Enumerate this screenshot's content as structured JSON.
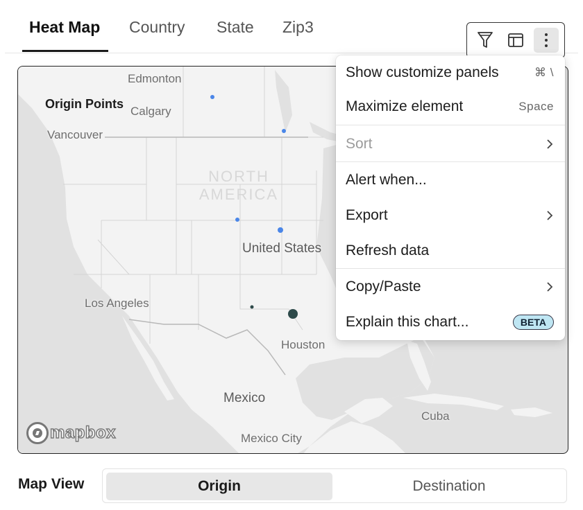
{
  "tabs": [
    {
      "label": "Heat Map",
      "active": true
    },
    {
      "label": "Country",
      "active": false
    },
    {
      "label": "State",
      "active": false
    },
    {
      "label": "Zip3",
      "active": false
    }
  ],
  "toolbar": {
    "icons": [
      "filter-icon",
      "table-layout-icon",
      "more-vertical-icon"
    ]
  },
  "map": {
    "legend_title": "Origin Points",
    "places": {
      "edmonton": "Edmonton",
      "calgary": "Calgary",
      "vancouver": "Vancouver",
      "continent": "NORTH AMERICA",
      "united_states": "United States",
      "los_angeles": "Los Angeles",
      "houston": "Houston",
      "mexico": "Mexico",
      "cuba": "Cuba",
      "mexico_city": "Mexico City"
    },
    "attribution": "mapbox",
    "colors": {
      "point_blue": "#4a86e8",
      "point_dark": "#2e4a4a",
      "land": "#f3f3f3",
      "water": "#e1e1e1"
    }
  },
  "menu": {
    "items": [
      {
        "label": "Show customize panels",
        "shortcut": "⌘ \\"
      },
      {
        "label": "Maximize element",
        "shortcut": "Space"
      },
      {
        "label": "Sort",
        "disabled": true,
        "submenu": true
      },
      {
        "label": "Alert when..."
      },
      {
        "label": "Export",
        "submenu": true
      },
      {
        "label": "Refresh data"
      },
      {
        "label": "Copy/Paste",
        "submenu": true
      },
      {
        "label": "Explain this chart...",
        "badge": "BETA"
      }
    ]
  },
  "map_view": {
    "label": "Map View",
    "options": [
      "Origin",
      "Destination"
    ],
    "selected": "Origin"
  }
}
